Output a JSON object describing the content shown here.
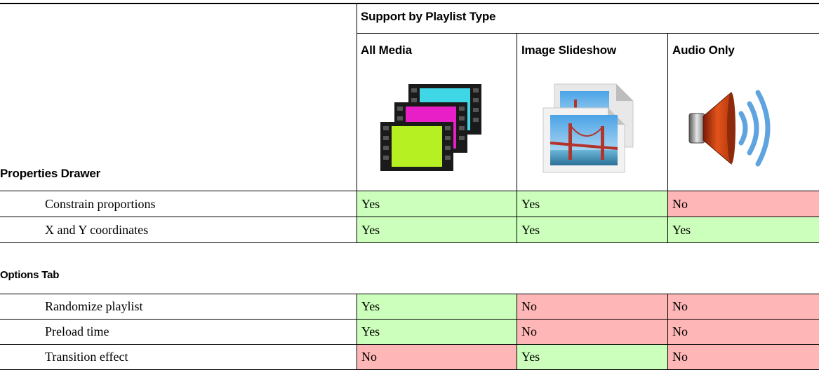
{
  "table": {
    "group_header": "Support by Playlist Type",
    "columns": [
      {
        "label": "All Media",
        "icon": "video-filmstrip-icon"
      },
      {
        "label": "Image Slideshow",
        "icon": "image-slideshow-icon"
      },
      {
        "label": "Audio Only",
        "icon": "speaker-audio-icon"
      }
    ],
    "sections": [
      {
        "title": "Properties Drawer",
        "rows": [
          {
            "label": "Constrain proportions",
            "values": [
              "Yes",
              "Yes",
              "No"
            ]
          },
          {
            "label": "X and Y coordinates",
            "values": [
              "Yes",
              "Yes",
              "Yes"
            ]
          }
        ]
      },
      {
        "title": "Options Tab",
        "rows": [
          {
            "label": "Randomize playlist",
            "values": [
              "Yes",
              "No",
              "No"
            ]
          },
          {
            "label": "Preload time",
            "values": [
              "Yes",
              "No",
              "No"
            ]
          },
          {
            "label": "Transition effect",
            "values": [
              "No",
              "Yes",
              "No"
            ]
          }
        ]
      }
    ],
    "colors": {
      "yes": "#ccffbb",
      "no": "#ffb6b6"
    }
  }
}
